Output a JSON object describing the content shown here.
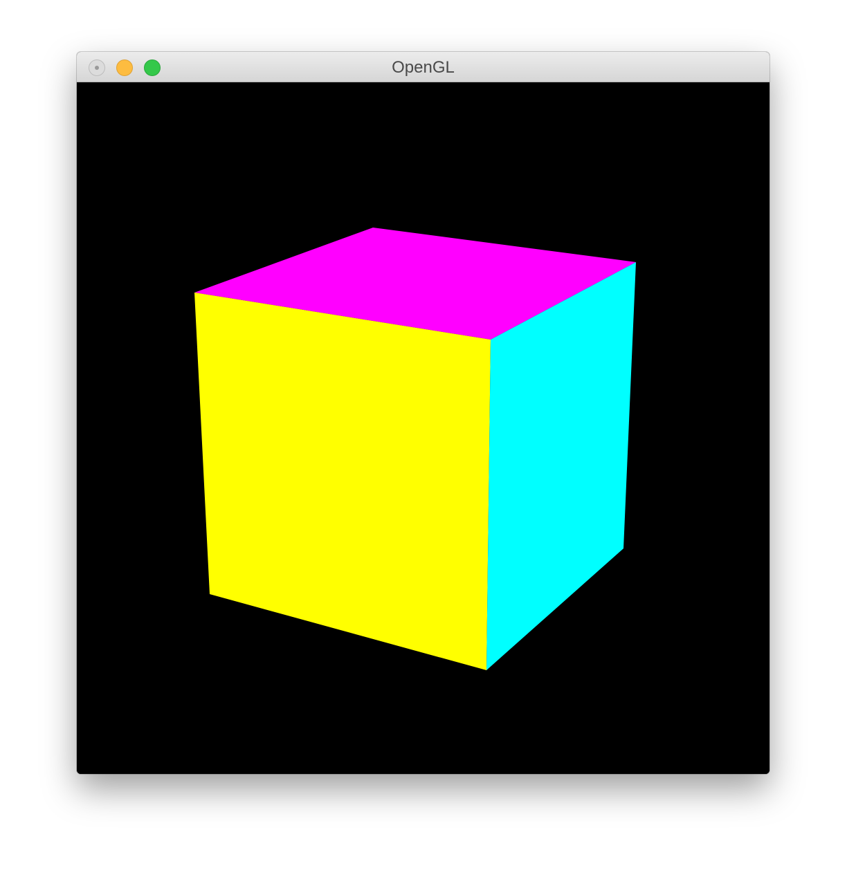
{
  "window": {
    "title": "OpenGL"
  },
  "titlebar_buttons": {
    "close_icon": "close-dot-icon",
    "minimize_color": "#fdbc40",
    "zoom_color": "#34c84a"
  },
  "scene": {
    "background_color": "#000000",
    "cube_faces": [
      {
        "name": "top",
        "color": "#ff00ff"
      },
      {
        "name": "front",
        "color": "#ffff00"
      },
      {
        "name": "right",
        "color": "#00ffff"
      }
    ]
  }
}
